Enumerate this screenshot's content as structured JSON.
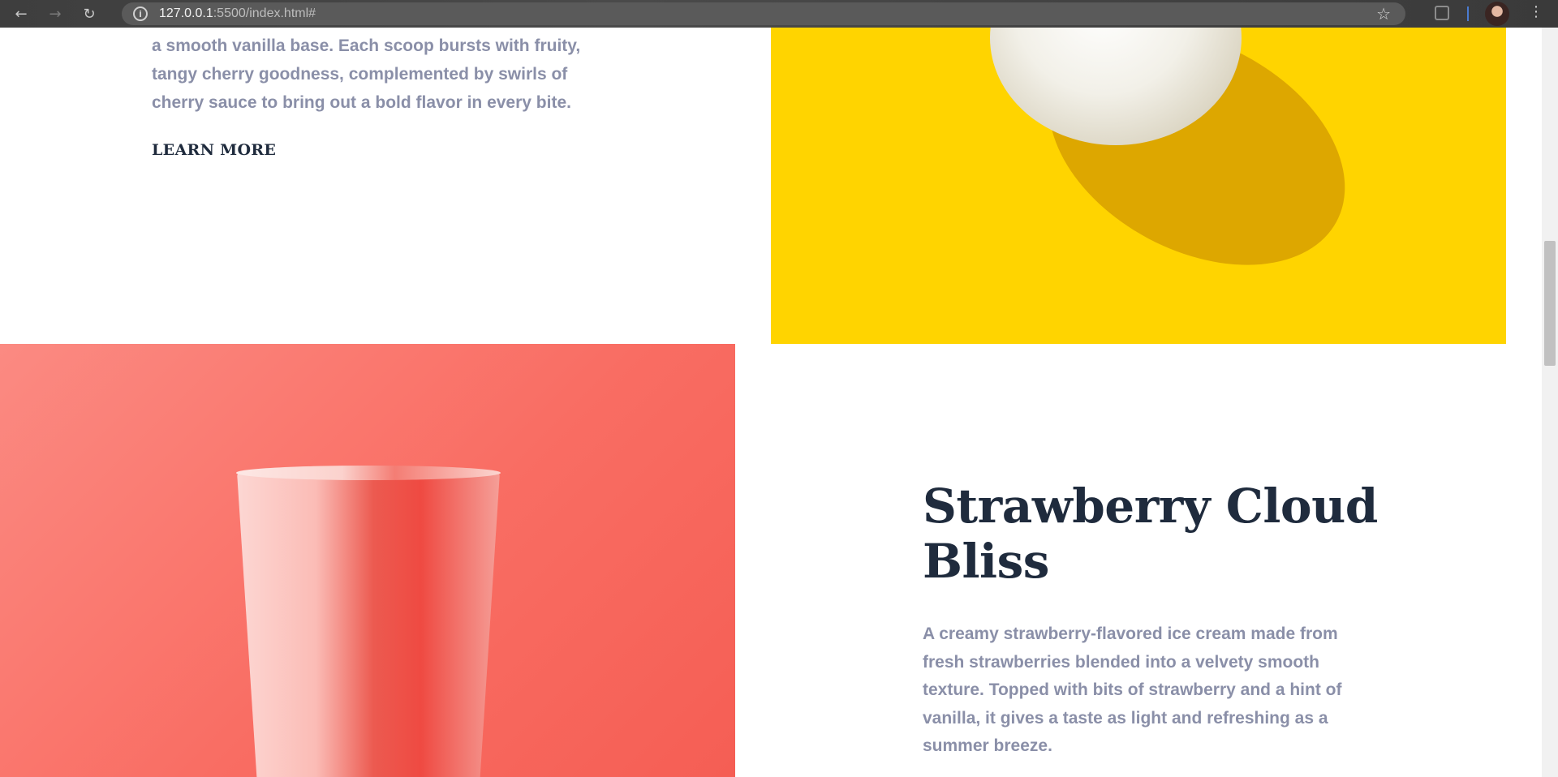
{
  "browser": {
    "back_icon": "←",
    "forward_icon": "→",
    "reload_icon": "↻",
    "url_host": "127.0.0.1",
    "url_rest": ":5500/index.html#",
    "star_icon": "☆",
    "menu_icon": "⋮"
  },
  "cherry_section": {
    "description_tail": "a smooth vanilla base. Each scoop bursts with fruity, tangy cherry goodness, complemented by swirls of cherry sauce to bring out a bold flavor in every bite.",
    "learn_more": "LEARN MORE"
  },
  "strawberry_section": {
    "title": "Strawberry Cloud Bliss",
    "description": "A creamy strawberry-flavored ice cream made from fresh strawberries blended into a velvety smooth texture. Topped with bits of strawberry and a hint of vanilla, it gives a taste as light and refreshing as a summer breeze."
  },
  "colors": {
    "yellow_panel": "#ffd400",
    "red_panel": "#f96d63",
    "heading": "#1f2b3d",
    "body_text": "#8a8fa8"
  }
}
